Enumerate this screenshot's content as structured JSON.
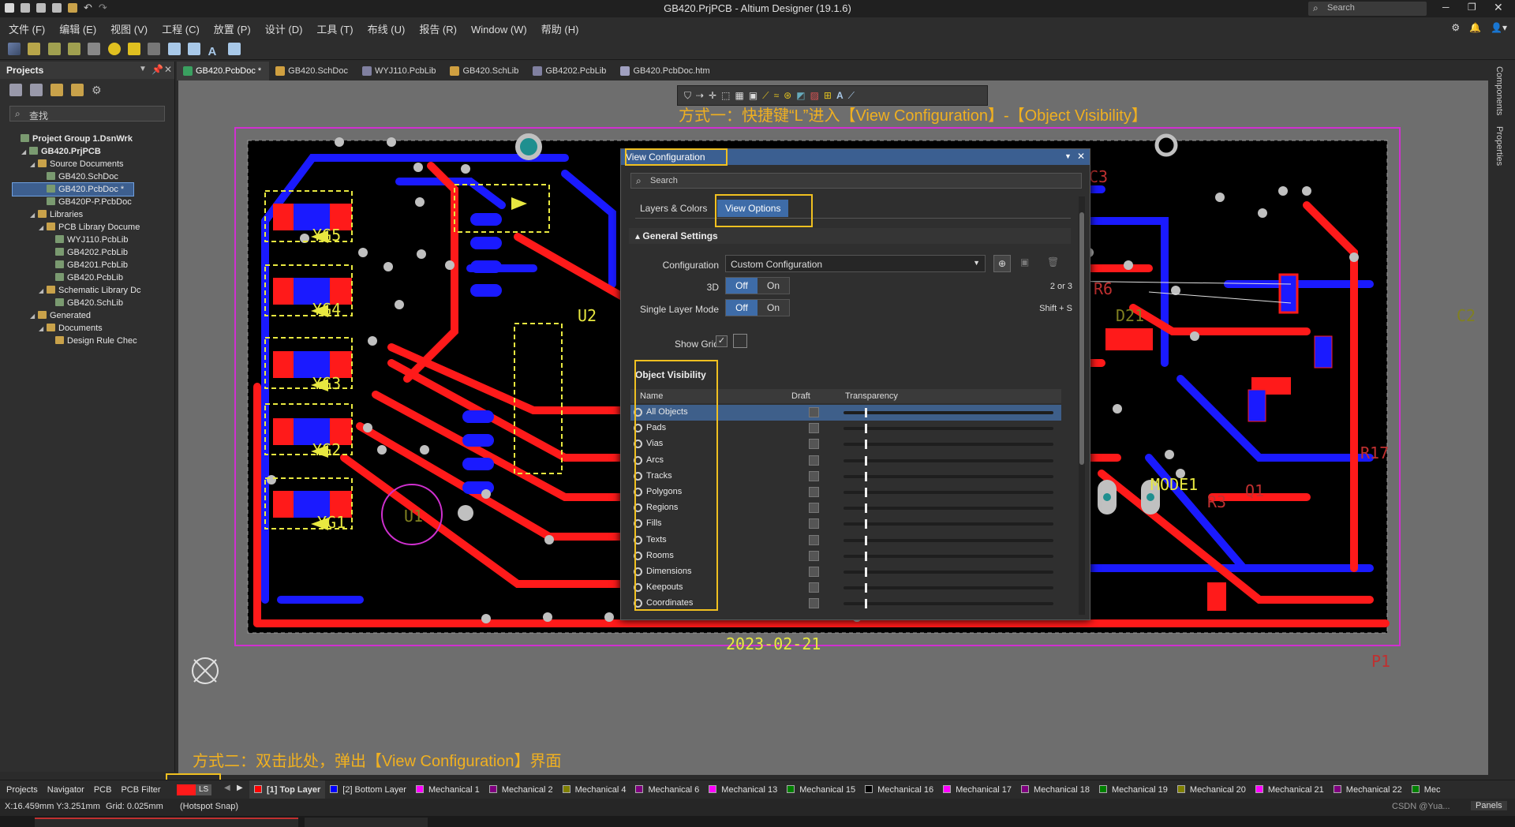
{
  "app": {
    "window_title": "GB420.PrjPCB - Altium Designer (19.1.6)",
    "search_placeholder": "Search"
  },
  "menu": [
    "文件 (F)",
    "编辑 (E)",
    "视图 (V)",
    "工程 (C)",
    "放置 (P)",
    "设计 (D)",
    "工具 (T)",
    "布线 (U)",
    "报告 (R)",
    "Window (W)",
    "帮助 (H)"
  ],
  "projects_panel": {
    "title": "Projects",
    "search_placeholder": "查找",
    "tree": [
      {
        "label": "Project Group 1.DsnWrk",
        "level": 0,
        "bold": true
      },
      {
        "label": "GB420.PrjPCB",
        "level": 1,
        "bold": true
      },
      {
        "label": "Source Documents",
        "level": 2
      },
      {
        "label": "GB420.SchDoc",
        "level": 3
      },
      {
        "label": "GB420.PcbDoc *",
        "level": 3,
        "selected": true
      },
      {
        "label": "GB420P-P.PcbDoc",
        "level": 3
      },
      {
        "label": "Libraries",
        "level": 2
      },
      {
        "label": "PCB Library Docume",
        "level": 3
      },
      {
        "label": "WYJ110.PcbLib",
        "level": 4
      },
      {
        "label": "GB4202.PcbLib",
        "level": 4
      },
      {
        "label": "GB4201.PcbLib",
        "level": 4
      },
      {
        "label": "GB420.PcbLib",
        "level": 4
      },
      {
        "label": "Schematic Library Dc",
        "level": 3
      },
      {
        "label": "GB420.SchLib",
        "level": 4
      },
      {
        "label": "Generated",
        "level": 2
      },
      {
        "label": "Documents",
        "level": 3
      },
      {
        "label": "Design Rule Chec",
        "level": 4
      }
    ]
  },
  "doc_tabs": [
    {
      "label": "GB420.PcbDoc *",
      "active": true,
      "color": "#3aa060"
    },
    {
      "label": "GB420.SchDoc",
      "color": "#d0a040"
    },
    {
      "label": "WYJ110.PcbLib",
      "color": "#8080a0"
    },
    {
      "label": "GB420.SchLib",
      "color": "#d0a040"
    },
    {
      "label": "GB4202.PcbLib",
      "color": "#8080a0"
    },
    {
      "label": "GB420.PcbDoc.htm",
      "color": "#a0a0c0"
    }
  ],
  "annotations": {
    "method1": "方式一：快捷键“L”进入【View Configuration】-【Object Visibility】",
    "method2": "方式二：双击此处，弹出【View Configuration】界面"
  },
  "pcb_labels": {
    "yg5": "YG5",
    "yg4": "YG4",
    "yg3": "YG3",
    "yg2": "YG2",
    "yg1": "YG1",
    "u2": "U2",
    "u1": "U1",
    "mode1": "MODE1",
    "q1": "Q1",
    "r3": "R3",
    "r17": "R17",
    "date": "2023-02-21",
    "c2": "C2",
    "d21": "D21",
    "r6": "R6",
    "p1": "P1",
    "c3": "C3"
  },
  "dialog": {
    "title": "View Configuration",
    "search_placeholder": "Search",
    "tabs": [
      "Layers & Colors",
      "View Options"
    ],
    "active_tab": "View Options",
    "general_settings": {
      "header": "General Settings",
      "configuration_label": "Configuration",
      "configuration_value": "Custom Configuration",
      "threed_label": "3D",
      "threed_hint": "2 or 3",
      "single_layer_label": "Single Layer Mode",
      "single_layer_hint": "Shift + S",
      "off": "Off",
      "on": "On",
      "show_grid_label": "Show Grid"
    },
    "object_visibility": {
      "header": "Object Visibility",
      "col_name": "Name",
      "col_draft": "Draft",
      "col_transparency": "Transparency",
      "items": [
        "All Objects",
        "Pads",
        "Vias",
        "Arcs",
        "Tracks",
        "Polygons",
        "Regions",
        "Fills",
        "Texts",
        "Rooms",
        "Dimensions",
        "Keepouts",
        "Coordinates"
      ],
      "transparency": 0.1
    }
  },
  "bottom_tabs": [
    "Projects",
    "Navigator",
    "PCB",
    "PCB Filter"
  ],
  "layer_indicator": "LS",
  "layers": [
    {
      "label": "[1] Top Layer",
      "color": "#ff0000",
      "active": true
    },
    {
      "label": "[2] Bottom Layer",
      "color": "#0000ff"
    },
    {
      "label": "Mechanical 1",
      "color": "#ff00ff"
    },
    {
      "label": "Mechanical 2",
      "color": "#800080"
    },
    {
      "label": "Mechanical 4",
      "color": "#808000"
    },
    {
      "label": "Mechanical 6",
      "color": "#800080"
    },
    {
      "label": "Mechanical 13",
      "color": "#ff00ff"
    },
    {
      "label": "Mechanical 15",
      "color": "#008000"
    },
    {
      "label": "Mechanical 16",
      "color": "#000000"
    },
    {
      "label": "Mechanical 17",
      "color": "#ff00ff"
    },
    {
      "label": "Mechanical 18",
      "color": "#800080"
    },
    {
      "label": "Mechanical 19",
      "color": "#008000"
    },
    {
      "label": "Mechanical 20",
      "color": "#808000"
    },
    {
      "label": "Mechanical 21",
      "color": "#ff00ff"
    },
    {
      "label": "Mechanical 22",
      "color": "#800080"
    },
    {
      "label": "Mec",
      "color": "#008000"
    }
  ],
  "status": {
    "coords": "X:16.459mm Y:3.251mm",
    "grid": "Grid: 0.025mm",
    "snap": "(Hotspot Snap)",
    "panels": "Panels",
    "watermark": "CSDN @Yua..."
  },
  "right_tabs": [
    "Components",
    "Properties"
  ],
  "colors": {
    "top": "#ff1a1a",
    "bottom": "#1a1aff",
    "silk": "#e8e840",
    "highlight": "#f0c020",
    "accent": "#3e6ca8"
  }
}
